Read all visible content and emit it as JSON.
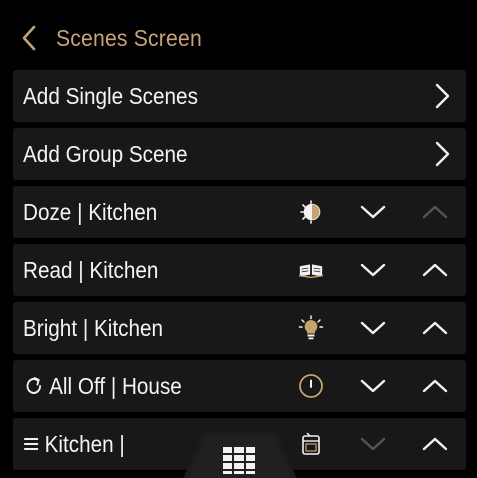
{
  "header": {
    "title": "Scenes Screen"
  },
  "nav_rows": [
    {
      "label": "Add Single Scenes"
    },
    {
      "label": "Add Group Scene"
    }
  ],
  "scenes": [
    {
      "label": "Doze | Kitchen",
      "icon": "half-moon-sun-icon",
      "up_enabled": false,
      "down_enabled": true
    },
    {
      "label": "Read | Kitchen",
      "icon": "open-book-icon",
      "up_enabled": true,
      "down_enabled": true
    },
    {
      "label": "Bright | Kitchen",
      "icon": "bright-bulb-icon",
      "up_enabled": true,
      "down_enabled": true
    },
    {
      "label": "All Off | House",
      "icon": "power-off-icon",
      "prefix_icon": "refresh-icon",
      "up_enabled": true,
      "down_enabled": true
    },
    {
      "label": "Kitchen |",
      "icon": "device-icon",
      "prefix_icon": "menu-icon",
      "up_enabled": true,
      "down_enabled": false
    }
  ],
  "colors": {
    "accent": "#c9a46a",
    "row_bg": "#181818",
    "disabled": "#555555"
  }
}
